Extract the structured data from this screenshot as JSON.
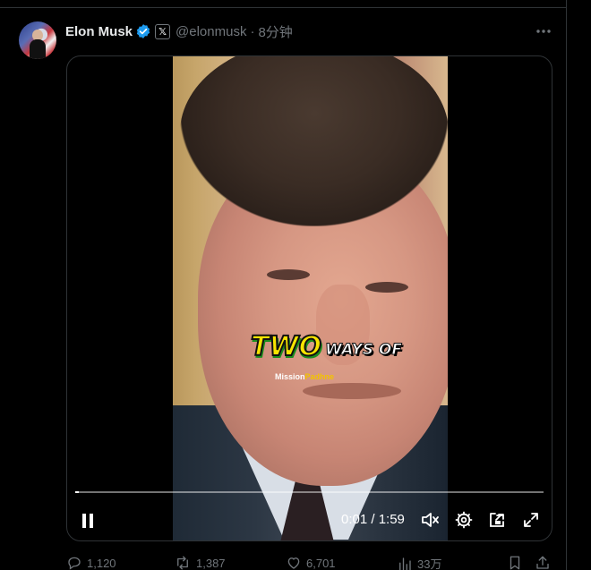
{
  "tweet": {
    "author_name": "Elon Musk",
    "handle": "@elonmusk",
    "separator": "·",
    "time_ago": "8分钟",
    "x_badge": "𝕏"
  },
  "video": {
    "caption_big": "TWO",
    "caption_rest": "WAYS OF",
    "watermark_a": "Mission",
    "watermark_b": "Padhne",
    "time_display": "0:01 / 1:59",
    "progress": 0.006
  },
  "actions": {
    "replies": "1,120",
    "reposts": "1,387",
    "likes": "6,701",
    "views": "33万"
  },
  "colors": {
    "background": "#000000",
    "verified_blue": "#1d9bf0",
    "muted_text": "#71767b",
    "caption_yellow": "#f7e400",
    "caption_green": "#1a8e1e"
  }
}
